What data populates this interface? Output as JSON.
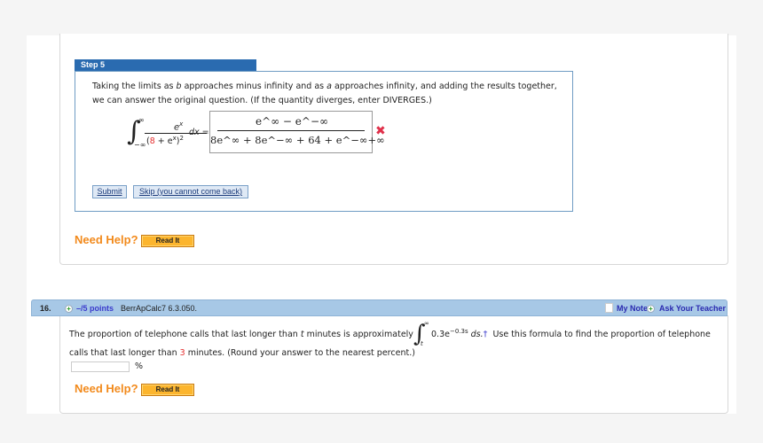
{
  "step": {
    "tab_label": "Step 5",
    "instructions_part1": "Taking the limits as ",
    "var_b": "b",
    "instructions_part2": " approaches minus infinity and as ",
    "var_a": "a",
    "instructions_part3": " approaches infinity, and adding the results together,",
    "instructions_line2": "we can answer the original question. (If the quantity diverges, enter DIVERGES.)",
    "integral": {
      "upper": "∞",
      "lower": "−∞",
      "numerator": "e",
      "numerator_exp": "x",
      "denominator_open": "(",
      "denominator_const": "8",
      "denominator_rest": " + e",
      "denominator_rest_exp": "x",
      "denominator_close": ")",
      "denominator_power": "2",
      "dx_eq": "dx ="
    },
    "answer": {
      "numerator": "e^∞ − e^−∞",
      "denominator": "8e^∞ + 8e^−∞ + 64 + e^−∞+∞",
      "status": "incorrect"
    },
    "buttons": {
      "submit": "Submit",
      "skip": "Skip (you cannot come back)"
    }
  },
  "help": {
    "need_help": "Need Help?",
    "read_it": "Read It"
  },
  "question16": {
    "number": "16.",
    "points": "–/5 points",
    "id": "BerrApCalc7 6.3.050.",
    "my_notes": "My Notes",
    "ask_teacher": "Ask Your Teacher",
    "text_part1": "The proportion of telephone calls that last longer than ",
    "var_t": "t",
    "text_part2": " minutes is approximately",
    "integral_upper": "∞",
    "integral_lower": "t",
    "integrand": "0.3e",
    "integrand_exp": "−0.3s",
    "ds": "ds.",
    "dagger": "†",
    "text_part3": "Use this formula to find the proportion of telephone",
    "line2_part1": "calls that last longer than ",
    "line2_value": "3",
    "line2_part2": " minutes. (Round your answer to the nearest percent.)",
    "answer_value": "",
    "unit": "%"
  },
  "colors": {
    "accent_blue": "#2a6bb0",
    "orange_help": "#f28a1c",
    "error_red": "#e0304a"
  }
}
